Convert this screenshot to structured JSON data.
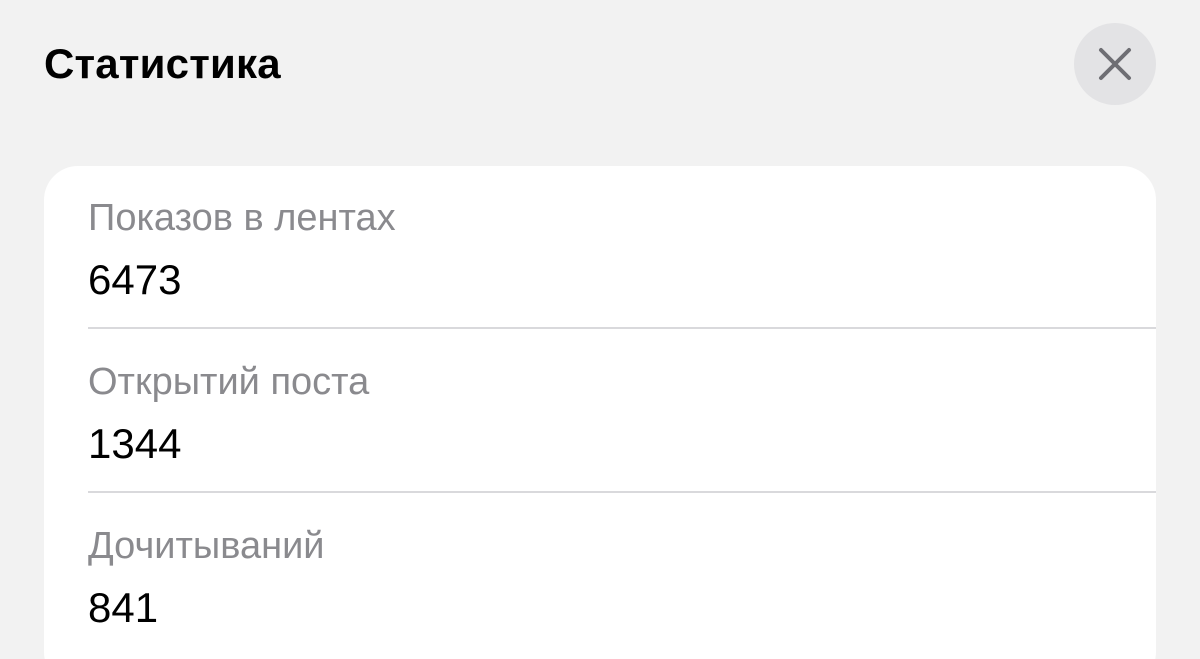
{
  "header": {
    "title": "Статистика",
    "close_icon": "close-icon"
  },
  "stats": {
    "items": [
      {
        "label": "Показов в лентах",
        "value": "6473"
      },
      {
        "label": "Открытий поста",
        "value": "1344"
      },
      {
        "label": "Дочитываний",
        "value": "841"
      }
    ]
  },
  "colors": {
    "background": "#f2f2f2",
    "card": "#ffffff",
    "label": "#8a8a8e",
    "value": "#000000",
    "close_button_bg": "#e3e3e5",
    "close_icon": "#6e6e73"
  }
}
